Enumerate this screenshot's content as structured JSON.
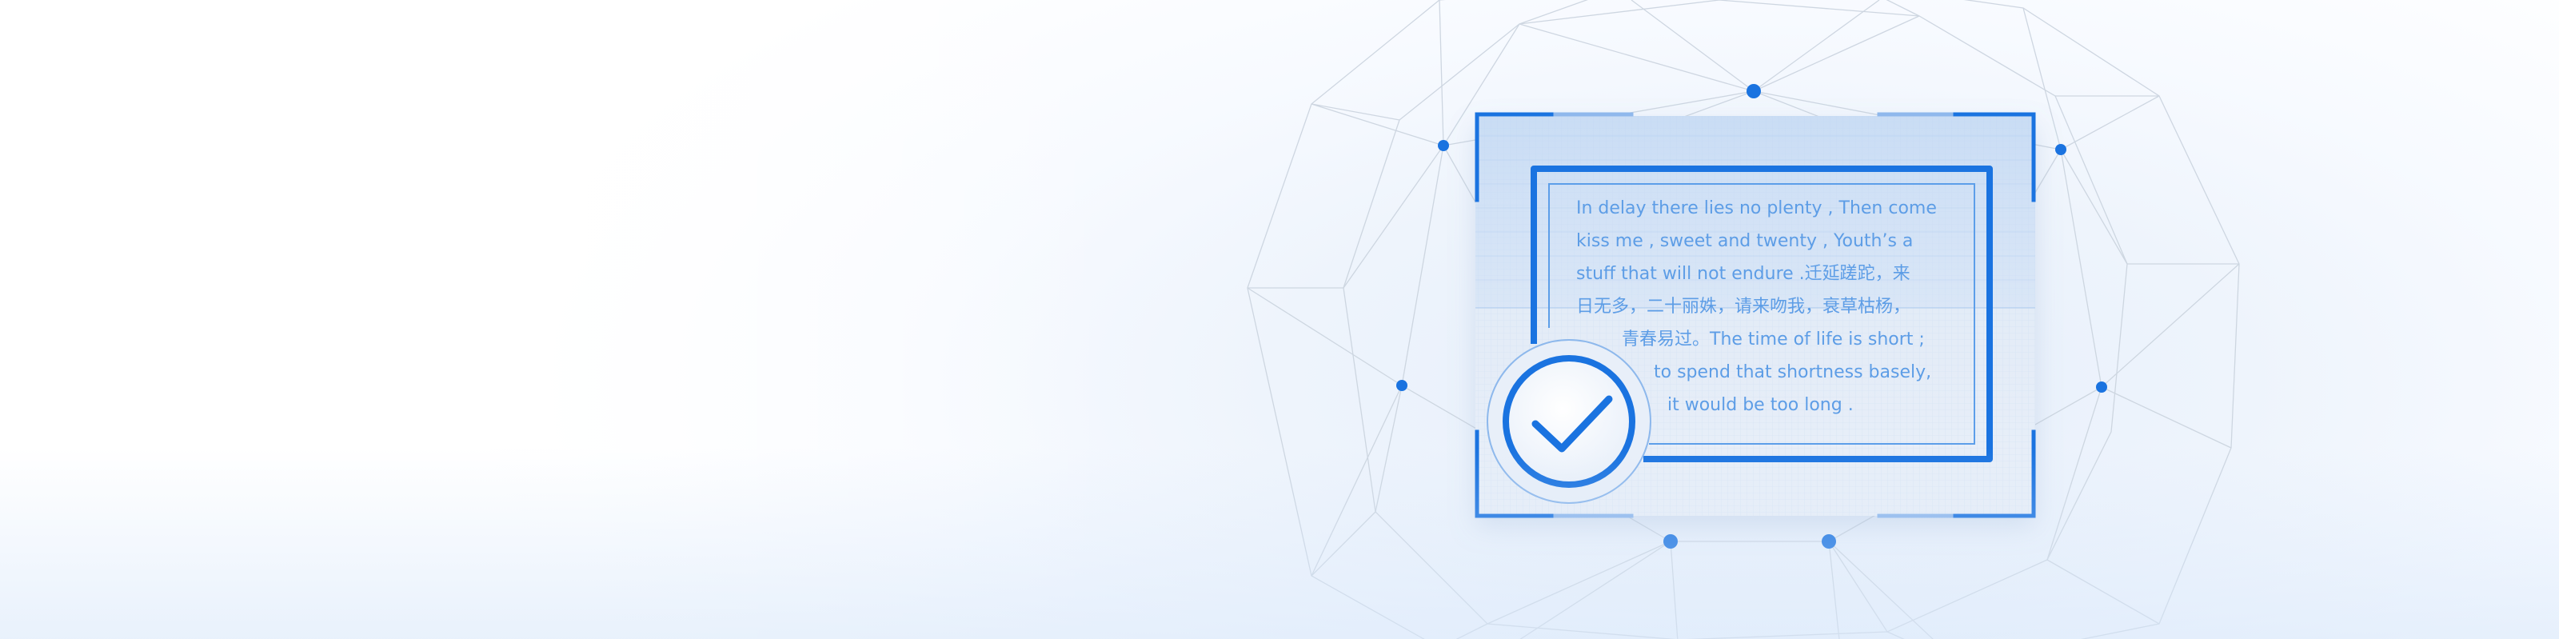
{
  "quote": {
    "lines": [
      "In delay there lies no plenty , Then come",
      "kiss me , sweet and twenty , Youth’s a",
      "stuff that will not endure .迁延蹉跎，来",
      "日无多，二十丽姝，请来吻我，衰草枯杨，",
      "青春易过。The time of life is short ;",
      "to spend that shortness basely,",
      "it would be too long ."
    ]
  },
  "badge": {
    "icon": "checkmark-icon"
  },
  "colors": {
    "accent": "#1a73e0",
    "text": "#5d9de6",
    "mesh": "#c9d3df",
    "node": "#1a73e0"
  }
}
